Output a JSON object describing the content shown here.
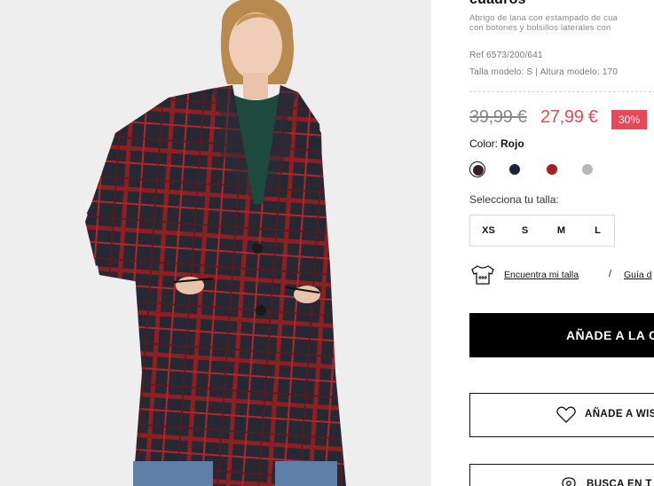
{
  "product": {
    "title": "cuadros",
    "description_lines": [
      "Abrigo de lana con estampado de cua",
      "con botones y bolsillos laterales con"
    ],
    "ref": "Ref 6573/200/641",
    "model_info": "Talla modelo: S | Altura modelo: 170",
    "price_old": "39,99 €",
    "price_new": "27,99 €",
    "discount": "30%"
  },
  "color": {
    "label": "Color:",
    "selected": "Rojo",
    "swatches": [
      {
        "name": "swatch-burgundy-check",
        "hex": "#3a1f24",
        "selected": true
      },
      {
        "name": "swatch-navy",
        "hex": "#1c2333",
        "selected": false
      },
      {
        "name": "swatch-red",
        "hex": "#a8201f",
        "selected": false
      },
      {
        "name": "swatch-grey",
        "hex": "#b8b8b8",
        "selected": false
      }
    ]
  },
  "size": {
    "label": "Selecciona tu talla:",
    "options": [
      "XS",
      "S",
      "M",
      "L"
    ]
  },
  "fit": {
    "icon": "tshirt-ruler-icon",
    "find_size": "Encuentra mi talla",
    "separator": "/",
    "guide": "Guía d"
  },
  "actions": {
    "add_to_cart": "AÑADE A LA C",
    "wishlist": "AÑADE A WIS",
    "wishlist_icon": "heart-icon",
    "find_store": "BUSCA EN T",
    "find_store_icon": "location-pin-icon"
  },
  "colors": {
    "sale": "#e8485a",
    "button_dark": "#000000"
  }
}
